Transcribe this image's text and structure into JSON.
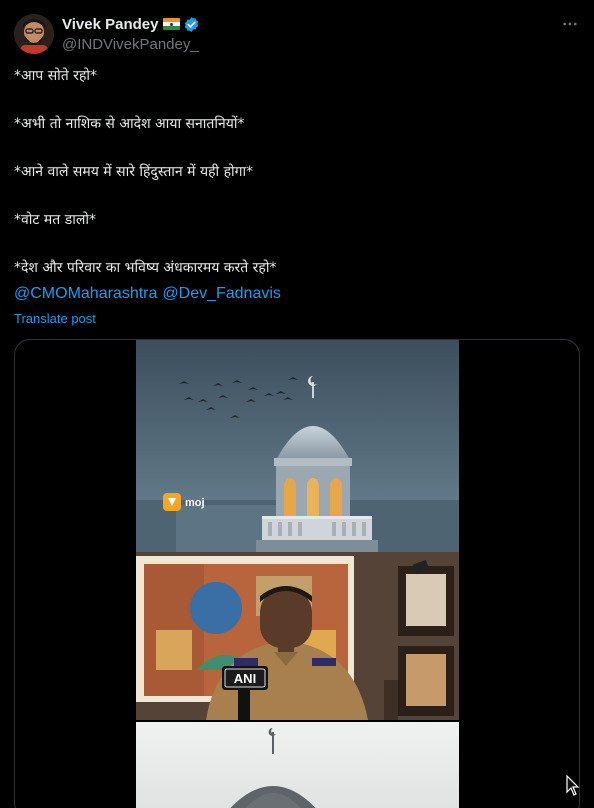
{
  "post": {
    "author": {
      "display_name": "Vivek Pandey",
      "handle": "@INDVivekPandey_",
      "flag_icon": "india-flag-icon",
      "verified_icon": "verified-badge-icon",
      "verified_color": "#1d9bf0"
    },
    "more_icon": "more-options-icon",
    "text_lines": [
      "*आप सोते रहो*",
      "*अभी तो नाशिक से आदेश आया सनातनियों*",
      "*आने वाले समय में सारे हिंदुस्तान में यही होगा*",
      "*वोट मत डालो*",
      "*देश और परिवार का भविष्य अंधकारमय करते रहो*"
    ],
    "mentions": [
      "@CMOMaharashtra",
      "@Dev_Fadnavis"
    ],
    "translate_label": "Translate post",
    "media": {
      "type": "video",
      "watermark_brand": "moj",
      "news_logo": "ANI"
    }
  },
  "colors": {
    "background": "#000000",
    "text": "#e7e9ea",
    "secondary_text": "#71767b",
    "link": "#1d9bf0",
    "border": "#2f3336"
  }
}
